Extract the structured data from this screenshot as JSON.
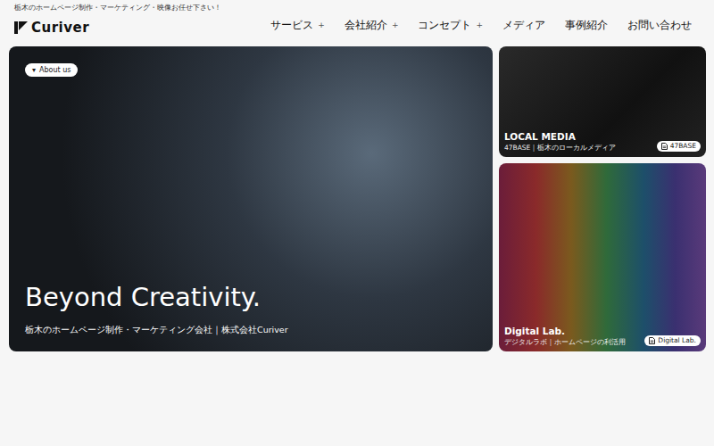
{
  "header": {
    "tagline": "栃木のホームページ制作・マーケティング・映像お任せ下さい！",
    "logo": "Curiver"
  },
  "nav": [
    {
      "label": "サービス",
      "plus": "+"
    },
    {
      "label": "会社紹介",
      "plus": "+"
    },
    {
      "label": "コンセプト",
      "plus": "+"
    },
    {
      "label": "メディア"
    },
    {
      "label": "事例紹介"
    },
    {
      "label": "お問い合わせ"
    }
  ],
  "hero": {
    "badge": {
      "icon": "▾",
      "label": "About us"
    },
    "title": "Beyond Creativity.",
    "subtitle": "栃木のホームページ制作・マーケティング会社｜株式会社Curiver"
  },
  "cards": [
    {
      "kind": "photo",
      "title": "LOCAL MEDIA",
      "subtitle": "47BASE｜栃木のローカルメディア",
      "badge": "47BASE"
    },
    {
      "kind": "gradient",
      "title": "Digital Lab.",
      "subtitle": "デジタルラボ｜ホームページの利活用",
      "badge": "Digital Lab."
    }
  ]
}
